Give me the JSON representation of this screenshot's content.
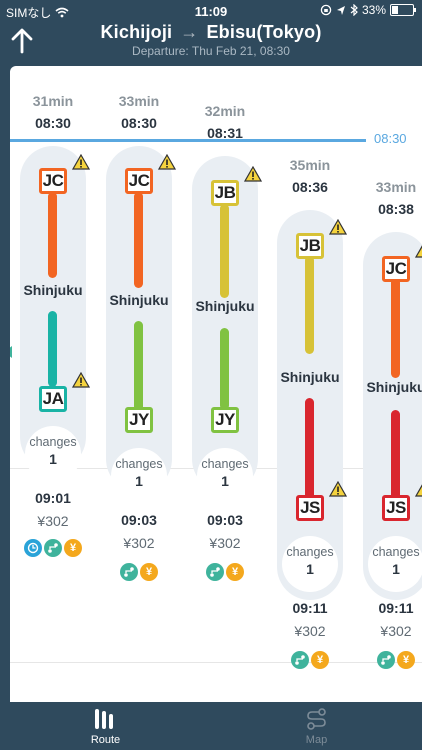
{
  "status_bar": {
    "carrier": "SIMなし",
    "time": "11:09",
    "battery": "33%"
  },
  "header": {
    "from": "Kichijoji",
    "arrow": "→",
    "to": "Ebisu(Tokyo)",
    "departure": "Departure: Thu Feb 21, 08:30"
  },
  "now_time": "08:30",
  "colors": {
    "JC": "#f26522",
    "JA": "#19b3a5",
    "JB": "#d7c237",
    "JY": "#80c241",
    "JS": "#d9262e",
    "accent": "#5aa8e0"
  },
  "routes": [
    {
      "duration": "31min",
      "departure": "08:30",
      "leg1": {
        "code": "JC",
        "color": "#f26522"
      },
      "transfer": "Shinjuku",
      "leg2": {
        "code": "JA",
        "color": "#19b3a5"
      },
      "changes_label": "changes",
      "changes": "1",
      "arrival": "09:01",
      "fare": "¥302",
      "icons": [
        "clock-icon",
        "route-icon",
        "yen-icon"
      ]
    },
    {
      "duration": "33min",
      "departure": "08:30",
      "leg1": {
        "code": "JC",
        "color": "#f26522"
      },
      "transfer": "Shinjuku",
      "leg2": {
        "code": "JY",
        "color": "#80c241"
      },
      "changes_label": "changes",
      "changes": "1",
      "arrival": "09:03",
      "fare": "¥302",
      "icons": [
        "route-icon",
        "yen-icon"
      ]
    },
    {
      "duration": "32min",
      "departure": "08:31",
      "leg1": {
        "code": "JB",
        "color": "#d7c237"
      },
      "transfer": "Shinjuku",
      "leg2": {
        "code": "JY",
        "color": "#80c241"
      },
      "changes_label": "changes",
      "changes": "1",
      "arrival": "09:03",
      "fare": "¥302",
      "icons": [
        "route-icon",
        "yen-icon"
      ]
    },
    {
      "duration": "35min",
      "departure": "08:36",
      "leg1": {
        "code": "JB",
        "color": "#d7c237"
      },
      "transfer": "Shinjuku",
      "leg2": {
        "code": "JS",
        "color": "#d9262e"
      },
      "changes_label": "changes",
      "changes": "1",
      "arrival": "09:11",
      "fare": "¥302",
      "icons": [
        "route-icon",
        "yen-icon"
      ]
    },
    {
      "duration": "33min",
      "departure": "08:38",
      "leg1": {
        "code": "JC",
        "color": "#f26522"
      },
      "transfer": "Shinjuku",
      "leg2": {
        "code": "JS",
        "color": "#d9262e"
      },
      "changes_label": "changes",
      "changes": "1",
      "arrival": "09:11",
      "fare": "¥302",
      "icons": [
        "route-icon",
        "yen-icon"
      ]
    }
  ],
  "tabs": [
    {
      "label": "Route",
      "icon": "route-bars-icon",
      "active": true
    },
    {
      "label": "Map",
      "icon": "map-path-icon",
      "active": false
    }
  ]
}
